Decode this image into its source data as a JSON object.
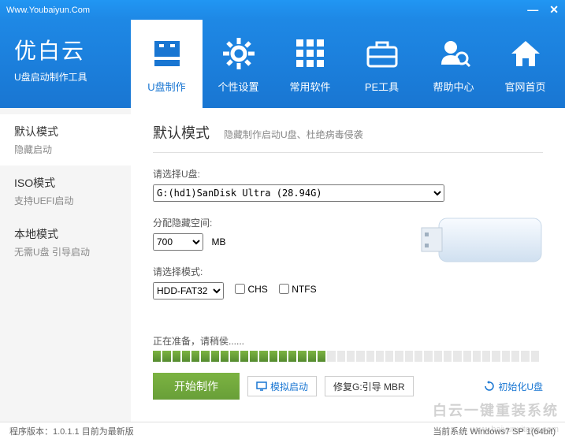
{
  "titlebar": {
    "url": "Www.Youbaiyun.Com"
  },
  "logo": {
    "title": "优白云",
    "sub": "U盘启动制作工具"
  },
  "nav": [
    {
      "label": "U盘制作"
    },
    {
      "label": "个性设置"
    },
    {
      "label": "常用软件"
    },
    {
      "label": "PE工具"
    },
    {
      "label": "帮助中心"
    },
    {
      "label": "官网首页"
    }
  ],
  "sidebar": [
    {
      "title": "默认模式",
      "sub": "隐藏启动"
    },
    {
      "title": "ISO模式",
      "sub": "支持UEFI启动"
    },
    {
      "title": "本地模式",
      "sub": "无需U盘 引导启动"
    }
  ],
  "main": {
    "title": "默认模式",
    "sub": "隐藏制作启动U盘、杜绝病毒侵袭",
    "usb_label": "请选择U盘:",
    "usb_value": "G:(hd1)SanDisk Ultra (28.94G)",
    "space_label": "分配隐藏空间:",
    "space_value": "700",
    "space_unit": "MB",
    "mode_label": "请选择模式:",
    "mode_value": "HDD-FAT32",
    "chs_label": "CHS",
    "ntfs_label": "NTFS",
    "progress_label": "正在准备，请稍侯......",
    "progress_pct": 45
  },
  "actions": {
    "start": "开始制作",
    "simulate": "模拟启动",
    "repair": "修复G:引导 MBR",
    "init": "初始化U盘"
  },
  "footer": {
    "version": "程序版本：1.0.1.1   目前为最新版",
    "os": "当前系统 Windows7 SP 1(64bit)"
  },
  "watermark": {
    "main": "白云一键重装系统",
    "sub": "www.baiyunxitong.com"
  }
}
